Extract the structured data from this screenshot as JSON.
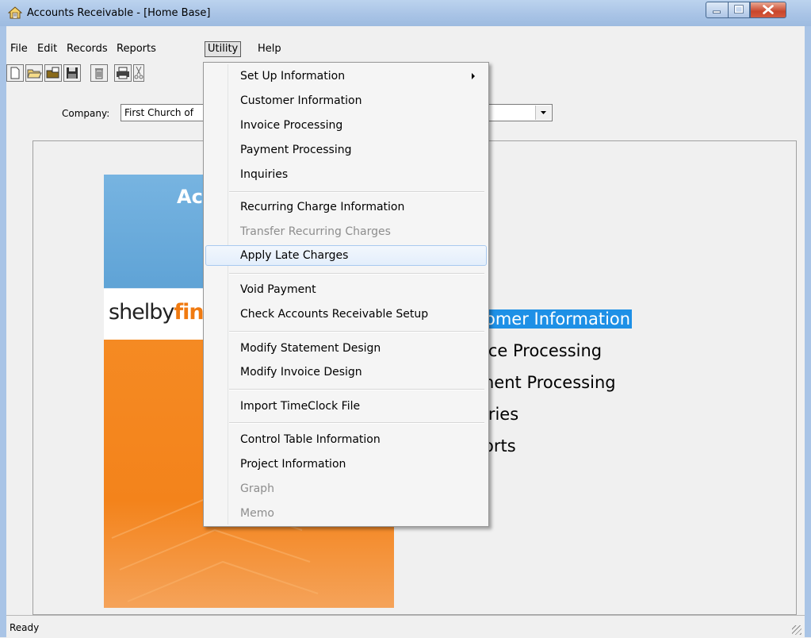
{
  "window": {
    "title": "Accounts Receivable - [Home Base]",
    "icon": "home-icon"
  },
  "menubar": {
    "items": [
      "File",
      "Edit",
      "Records",
      "Reports",
      "Utility",
      "Help"
    ],
    "active": "Utility"
  },
  "toolbar": {
    "icons": [
      "new-document-icon",
      "open-folder-icon",
      "open-file-icon",
      "save-icon",
      "delete-icon",
      "print-icon",
      "cut-icon"
    ]
  },
  "company": {
    "label": "Company:",
    "value": "First Church of"
  },
  "banner": {
    "title": "Acc",
    "logo_part1": "shelby",
    "logo_part2": "finan"
  },
  "home_links": [
    "omer Information",
    "ice Processing",
    "nent Processing",
    "iries",
    "orts"
  ],
  "utility_menu": {
    "groups": [
      [
        {
          "label": "Set Up Information",
          "submenu": true
        },
        {
          "label": "Customer Information"
        },
        {
          "label": "Invoice Processing"
        },
        {
          "label": "Payment Processing"
        },
        {
          "label": "Inquiries"
        }
      ],
      [
        {
          "label": "Recurring Charge Information"
        },
        {
          "label": "Transfer Recurring Charges",
          "disabled": true
        },
        {
          "label": "Apply Late Charges",
          "hover": true
        }
      ],
      [
        {
          "label": "Void Payment"
        },
        {
          "label": "Check Accounts Receivable Setup"
        }
      ],
      [
        {
          "label": "Modify Statement Design"
        },
        {
          "label": "Modify Invoice Design"
        }
      ],
      [
        {
          "label": "Import TimeClock File"
        }
      ],
      [
        {
          "label": "Control Table Information"
        },
        {
          "label": "Project Information"
        },
        {
          "label": "Graph",
          "disabled": true
        },
        {
          "label": "Memo",
          "disabled": true
        }
      ]
    ]
  },
  "status": {
    "text": "Ready"
  },
  "colors": {
    "title_bar": "#a9c4e6",
    "selection": "#1e90e6",
    "banner_blue": "#6aaddb",
    "banner_orange": "#f58a23",
    "close_button": "#c9462c"
  }
}
